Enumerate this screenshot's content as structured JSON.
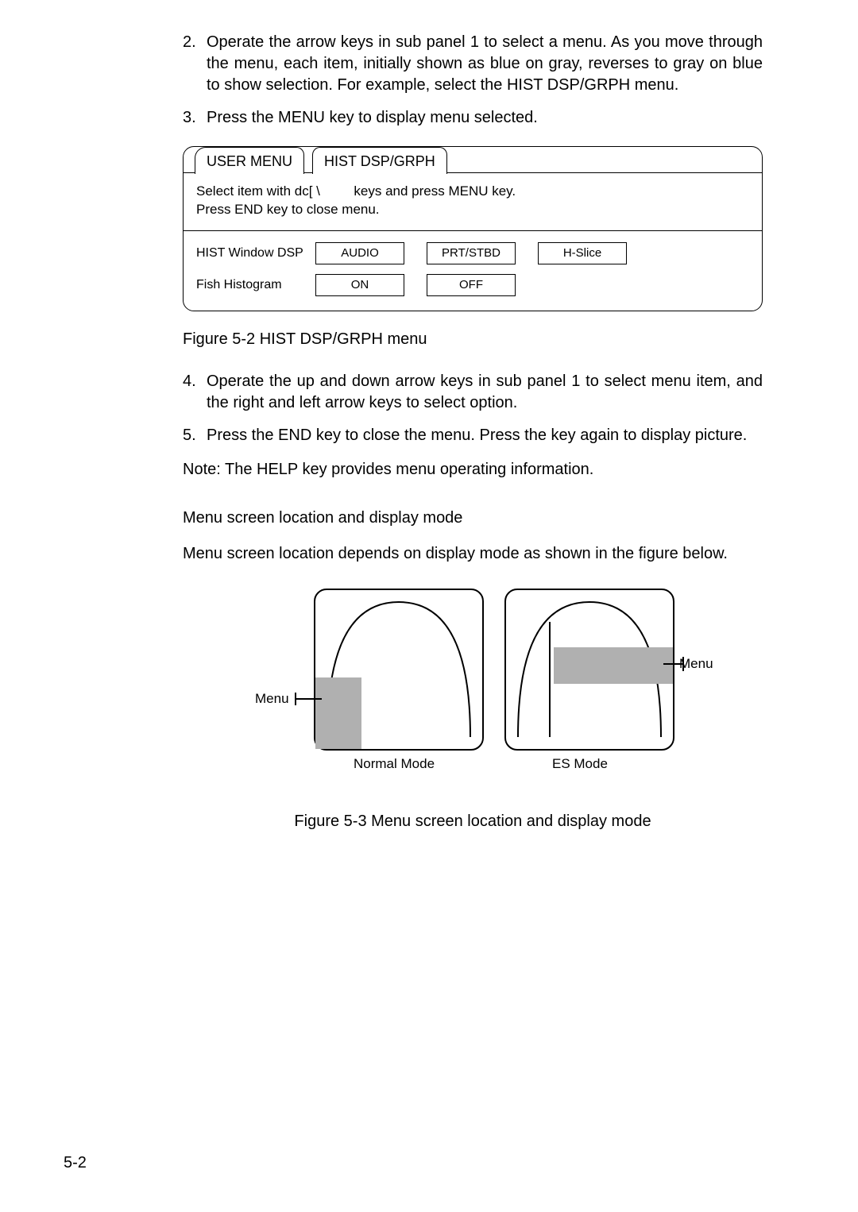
{
  "step2_num": "2.",
  "step2_text": "Operate the arrow keys in sub panel 1 to select a menu. As you move through the menu, each item, initially shown as blue on gray, reverses to gray on blue to show selection. For example, select the HIST DSP/GRPH menu.",
  "step3_num": "3.",
  "step3_text": "Press the MENU key to display menu selected.",
  "tab_user_menu": "USER MENU",
  "tab_hist": "HIST DSP/GRPH",
  "instr_line1": "Select item with dc[ \\         keys and press MENU key.",
  "instr_line2": "Press END key to close menu.",
  "row1_label": "HIST Window DSP",
  "row1_opt1": "AUDIO",
  "row1_opt2": "PRT/STBD",
  "row1_opt3": "H-Slice",
  "row2_label": "Fish Histogram",
  "row2_opt1": "ON",
  "row2_opt2": "OFF",
  "fig52_caption": "Figure 5-2 HIST DSP/GRPH menu",
  "step4_num": "4.",
  "step4_text": "Operate the up and down arrow keys in sub panel 1 to select menu item, and the right and left arrow keys to select option.",
  "step5_num": "5.",
  "step5_text": "Press the END key to close the menu. Press the key again to display picture.",
  "note_text": "Note: The HELP key provides menu operating information.",
  "subhead_text": "Menu screen location and display mode",
  "para_text": "Menu screen location depends on display mode as shown in the figure below.",
  "menu_label": "Menu",
  "normal_mode": "Normal Mode",
  "es_mode": "ES Mode",
  "fig53_caption": "Figure 5-3 Menu screen location and display mode",
  "page_num": "5-2"
}
